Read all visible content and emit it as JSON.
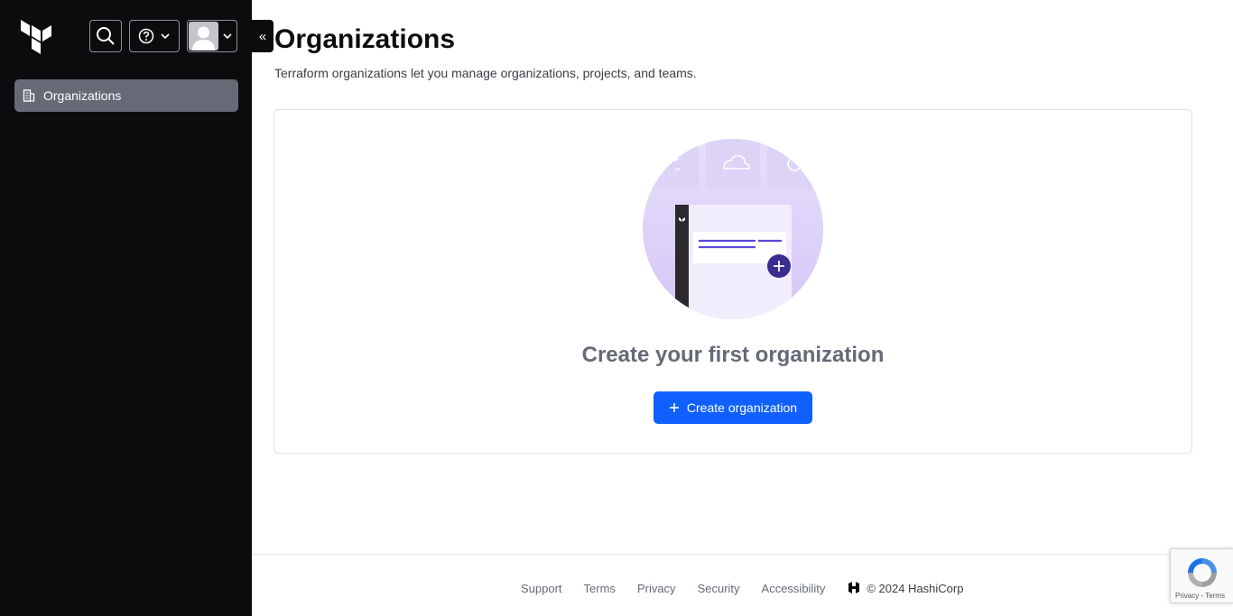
{
  "sidebar": {
    "nav_items": [
      {
        "label": "Organizations",
        "icon": "building-icon",
        "active": true
      }
    ]
  },
  "header": {
    "collapse_symbol": "«"
  },
  "main": {
    "title": "Organizations",
    "description": "Terraform organizations let you manage organizations, projects, and teams.",
    "empty_state": {
      "title": "Create your first organization",
      "button_label": "Create organization",
      "button_icon": "plus-icon"
    }
  },
  "footer": {
    "links": [
      "Support",
      "Terms",
      "Privacy",
      "Security",
      "Accessibility"
    ],
    "copyright": "© 2024 HashiCorp"
  },
  "recaptcha": {
    "text": "Privacy - Terms"
  },
  "colors": {
    "sidebar_bg": "#0c0c0e",
    "nav_active": "#656a76",
    "primary": "#1060ff",
    "illustration_purple": "#5b4ad6"
  }
}
